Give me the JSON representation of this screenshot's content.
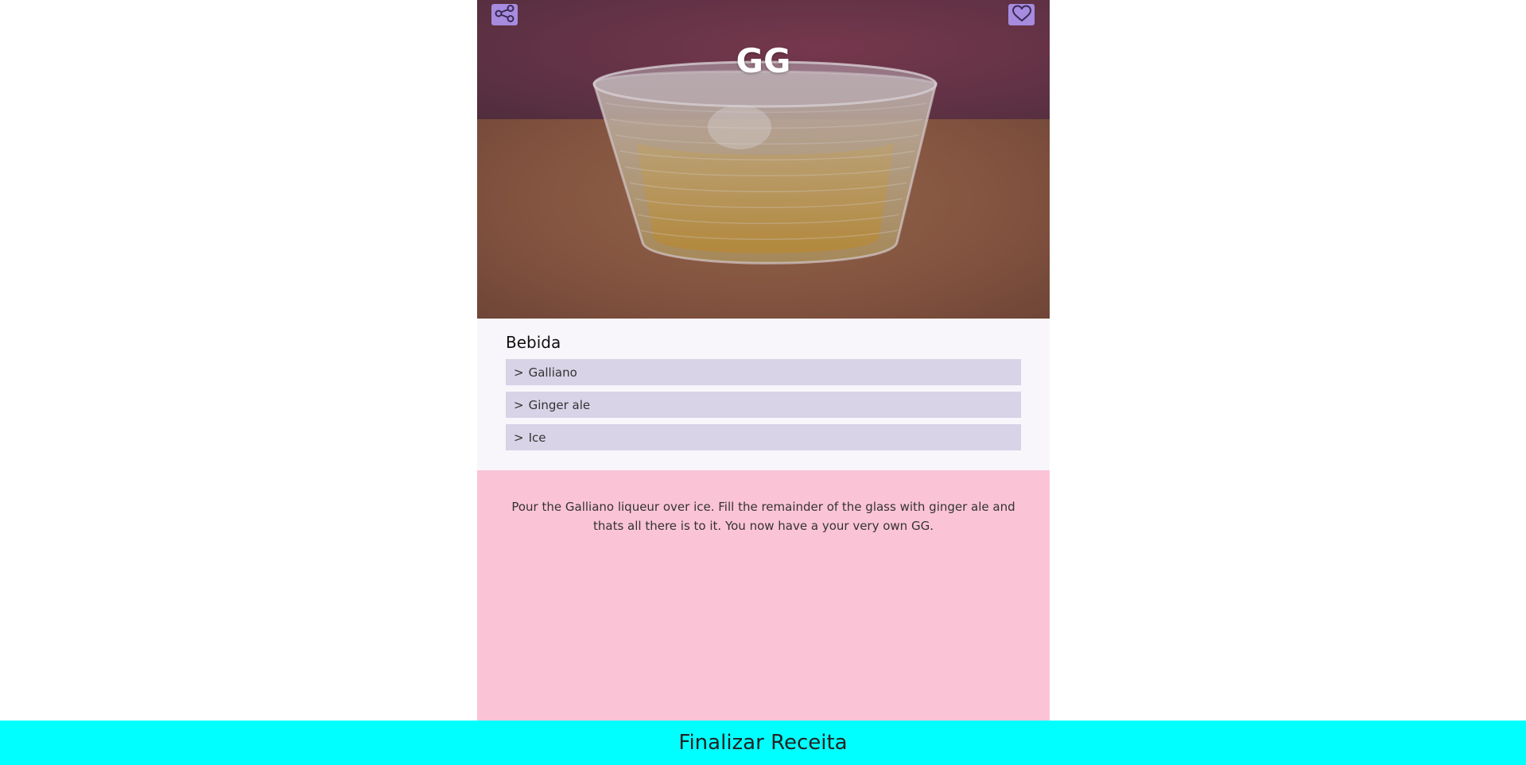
{
  "recipe": {
    "title": "GG",
    "category": "Bebida",
    "ingredients": [
      "Galliano",
      "Ginger ale",
      "Ice"
    ],
    "instructions": "Pour the Galliano liqueur over ice. Fill the remainder of the glass with ginger ale and thats all there is to it. You now have a your very own GG."
  },
  "ingredient_marker": ">",
  "actions": {
    "share_icon": "share-icon",
    "favorite_icon": "heart-icon",
    "finish_label": "Finalizar Receita"
  },
  "colors": {
    "icon_button": "#a78bdf",
    "ingredient_bg": "#d8d3e7",
    "instructions_bg": "#fbc4d6",
    "finish_button": "#00ffff"
  }
}
